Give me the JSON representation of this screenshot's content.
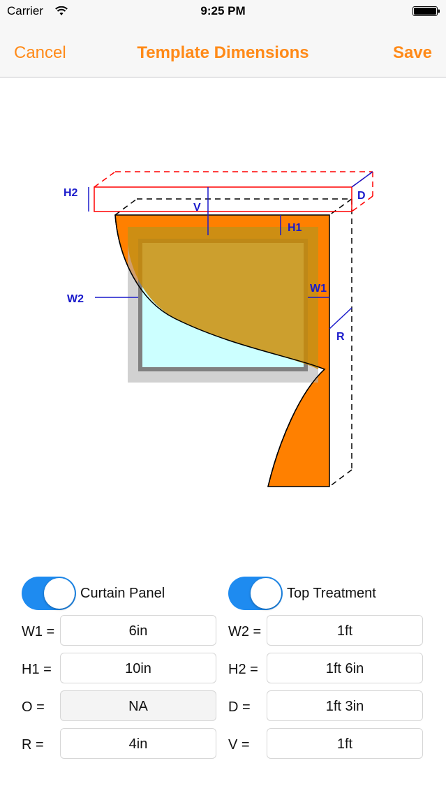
{
  "status_bar": {
    "carrier": "Carrier",
    "time": "9:25 PM"
  },
  "nav": {
    "cancel_label": "Cancel",
    "title": "Template Dimensions",
    "save_label": "Save"
  },
  "diagram": {
    "labels": {
      "h2": "H2",
      "v": "V",
      "d": "D",
      "h1": "H1",
      "w1": "W1",
      "w2": "W2",
      "r": "R"
    },
    "colors": {
      "curtain": "#ff8000",
      "window_frame": "#808080",
      "glass": "#ccffff",
      "rod_outline": "#ff0000",
      "dimension_lines": "#1a1acb"
    }
  },
  "toggles": {
    "curtain_panel": {
      "label": "Curtain Panel",
      "on": true
    },
    "top_treatment": {
      "label": "Top Treatment",
      "on": true
    }
  },
  "fields": {
    "w1": {
      "label": "W1 =",
      "value": "6in"
    },
    "h1": {
      "label": "H1 =",
      "value": "10in"
    },
    "o": {
      "label": "O =",
      "value": "NA"
    },
    "r": {
      "label": "R =",
      "value": "4in"
    },
    "w2": {
      "label": "W2 =",
      "value": "1ft"
    },
    "h2": {
      "label": "H2 =",
      "value": "1ft 6in"
    },
    "d": {
      "label": "D =",
      "value": "1ft 3in"
    },
    "v": {
      "label": "V =",
      "value": "1ft"
    }
  },
  "accent_color": "#ff8a18",
  "toggle_color": "#1e8bf0"
}
